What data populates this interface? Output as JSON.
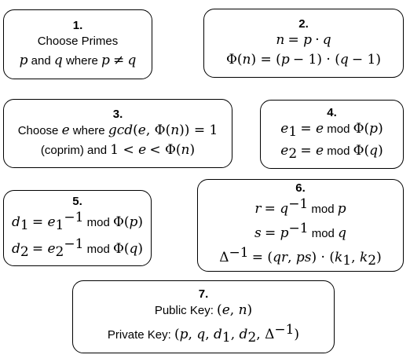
{
  "steps": [
    {
      "num": "1.",
      "title": "Choose Primes",
      "text": "p and q where p ≠ q"
    },
    {
      "num": "2.",
      "lines": [
        "n = p · q",
        "Φ(n) = (p − 1) · (q − 1)"
      ]
    },
    {
      "num": "3.",
      "lines": [
        "Choose e where gcd(e, Φ(n)) = 1",
        "(coprim) and 1 < e < Φ(n)"
      ]
    },
    {
      "num": "4.",
      "lines": [
        "e1 = e mod Φ(p)",
        "e2 = e mod Φ(q)"
      ]
    },
    {
      "num": "5.",
      "lines": [
        "d1 = e1^−1 mod Φ(p)",
        "d2 = e2^−1 mod Φ(q)"
      ]
    },
    {
      "num": "6.",
      "lines": [
        "r = q^−1 mod p",
        "s = p^−1 mod q",
        "Δ^−1 = (qr, ps) · (k1, k2)"
      ]
    },
    {
      "num": "7.",
      "lines": [
        "Public Key: (e, n)",
        "Private Key: (p, q, d1, d2, Δ^−1)"
      ]
    }
  ]
}
